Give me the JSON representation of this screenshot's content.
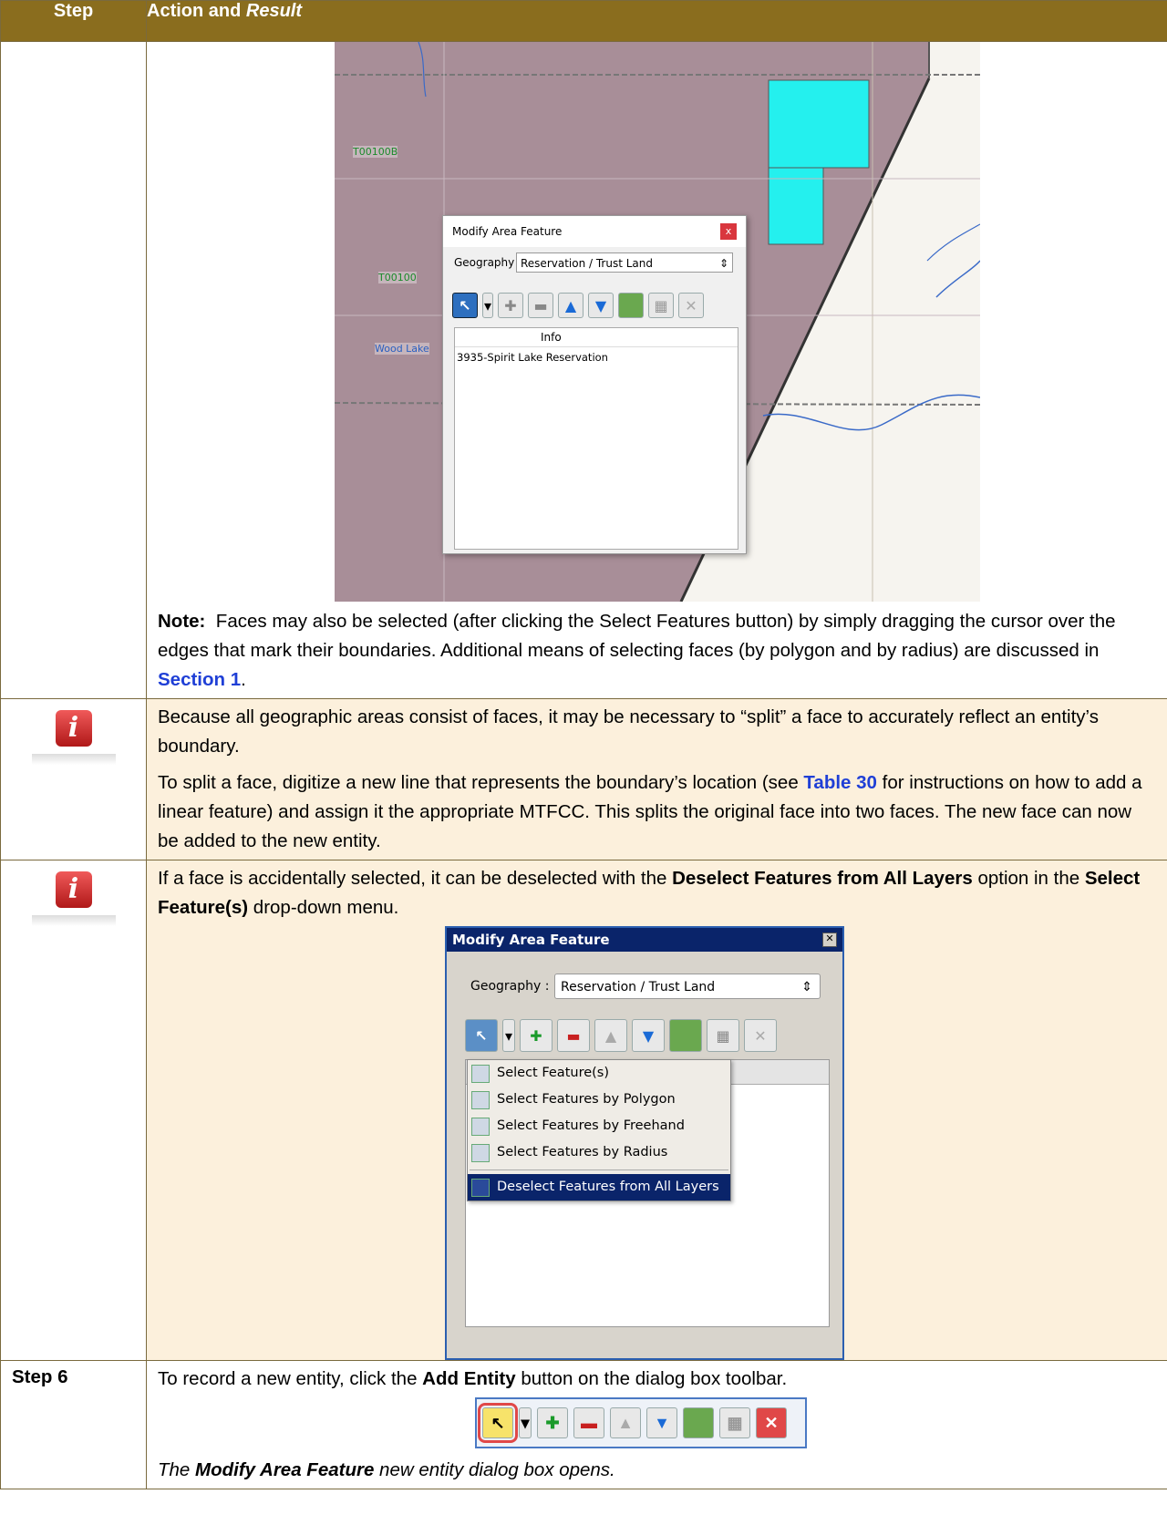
{
  "header": {
    "step": "Step",
    "action_prefix": "Action and ",
    "action_result": "Result"
  },
  "map": {
    "labels": [
      "T00100B",
      "T00100",
      "Wood Lake"
    ],
    "dialog": {
      "title": "Modify Area Feature",
      "close": "x",
      "geography_label": "Geography",
      "geography_value": "Reservation / Trust Land",
      "grid_header": "Info",
      "rows": [
        "3935-Spirit Lake Reservation"
      ]
    }
  },
  "note": {
    "label": "Note:",
    "text": "Faces may also be selected (after clicking the Select Features button) by simply dragging the cursor over the edges that mark their boundaries. Additional means of selecting faces (by polygon and by radius) are discussed in ",
    "link": "Section 1",
    "end": "."
  },
  "info1": {
    "p1": "Because all geographic areas consist of faces, it may be necessary to “split” a face to accurately reflect an entity’s boundary.",
    "p2_a": "To split a face, digitize a new line that represents the boundary’s location (see ",
    "p2_link": "Table 30",
    "p2_b": " for instructions on how to add a linear feature) and assign it the appropriate MTFCC. This splits the original face into two faces. The new face can now be added to the new entity."
  },
  "info2": {
    "a": "If a face is accidentally selected, it can be deselected with the ",
    "b": "Deselect Features from All Layers",
    "c": " option in the ",
    "d": "Select Feature(s)",
    "e": " drop-down menu.",
    "dialog": {
      "title": "Modify Area Feature",
      "geography_label": "Geography :",
      "geography_value": "Reservation / Trust Land",
      "menu": [
        "Select Feature(s)",
        "Select Features by Polygon",
        "Select Features by Freehand",
        "Select Features by Radius"
      ],
      "menu_highlight": "Deselect Features from All Layers"
    }
  },
  "step6": {
    "num": "Step 6",
    "a": "To record a new entity, click the ",
    "b": "Add Entity",
    "c": " button on the dialog box toolbar.",
    "result_bold": "Modify Area Feature",
    "result_rest": " new entity dialog box opens.",
    "result_pre": "The "
  },
  "colors": {
    "header": "#8a6d1e",
    "beige": "#fcf0dc",
    "link": "#1f3fd6",
    "selected_face": "#24f0ee",
    "reservation": "#a88e98"
  },
  "icons": [
    "select-features-icon",
    "add-icon",
    "remove-icon",
    "up-icon",
    "down-icon",
    "map-icon",
    "table-icon",
    "delete-icon",
    "info-icon"
  ]
}
